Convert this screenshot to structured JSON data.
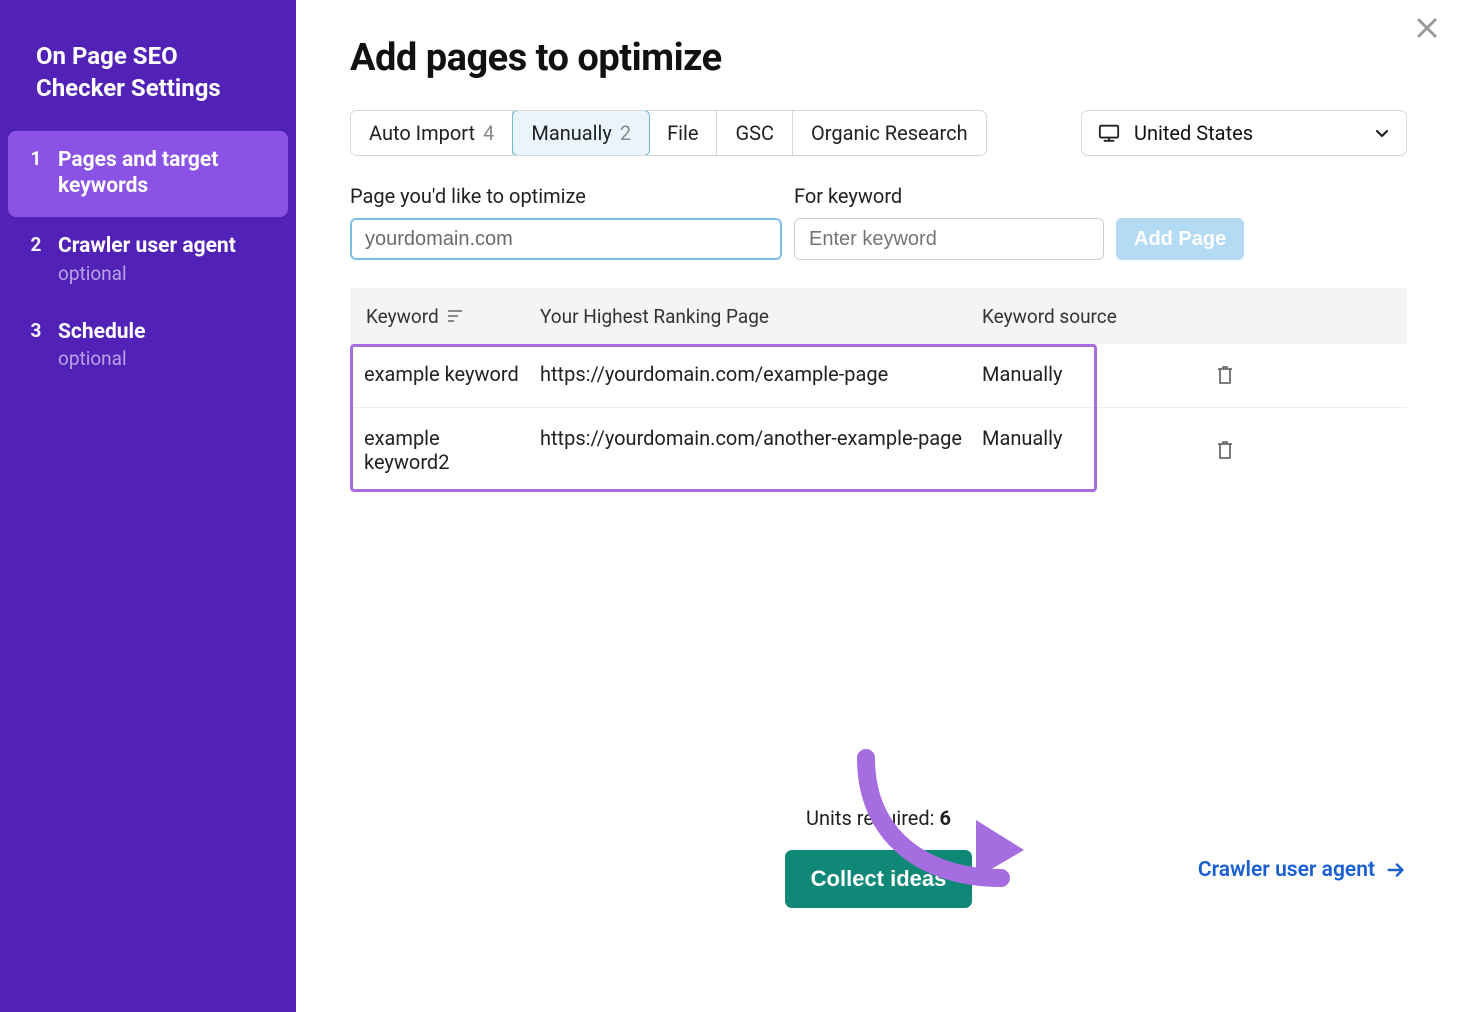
{
  "sidebar": {
    "title_line1": "On Page SEO",
    "title_line2": "Checker Settings",
    "steps": [
      {
        "num": "1",
        "label": "Pages and target keywords",
        "sub": "",
        "active": true
      },
      {
        "num": "2",
        "label": "Crawler user agent",
        "sub": "optional",
        "active": false
      },
      {
        "num": "3",
        "label": "Schedule",
        "sub": "optional",
        "active": false
      }
    ]
  },
  "main": {
    "title": "Add pages to optimize",
    "tabs": [
      {
        "label": "Auto Import",
        "count": "4",
        "active": false
      },
      {
        "label": "Manually",
        "count": "2",
        "active": true
      },
      {
        "label": "File",
        "count": "",
        "active": false
      },
      {
        "label": "GSC",
        "count": "",
        "active": false
      },
      {
        "label": "Organic Research",
        "count": "",
        "active": false
      }
    ],
    "country": {
      "label": "United States"
    },
    "form": {
      "page_label": "Page you'd like to optimize",
      "page_value": "yourdomain.com",
      "kw_label": "For keyword",
      "kw_placeholder": "Enter keyword",
      "add_button": "Add Page"
    },
    "table": {
      "headers": {
        "kw": "Keyword",
        "page": "Your Highest Ranking Page",
        "src": "Keyword source"
      },
      "rows": [
        {
          "kw": "example keyword",
          "page": "https://yourdomain.com/example-page",
          "src": "Manually"
        },
        {
          "kw": "example keyword2",
          "page": "https://yourdomain.com/another-example-page",
          "src": "Manually"
        }
      ]
    },
    "footer": {
      "units_label": "Units required: ",
      "units_count": "6",
      "collect_button": "Collect ideas",
      "next_link": "Crawler user agent"
    }
  }
}
